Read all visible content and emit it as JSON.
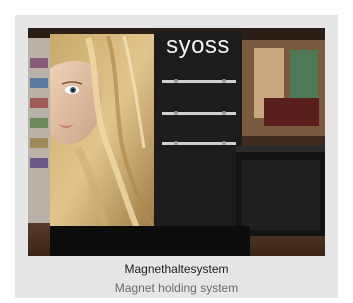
{
  "photo": {
    "brand_label": "syoss"
  },
  "caption": {
    "title": "Magnethaltesystem",
    "subtitle": "Magnet holding system"
  }
}
